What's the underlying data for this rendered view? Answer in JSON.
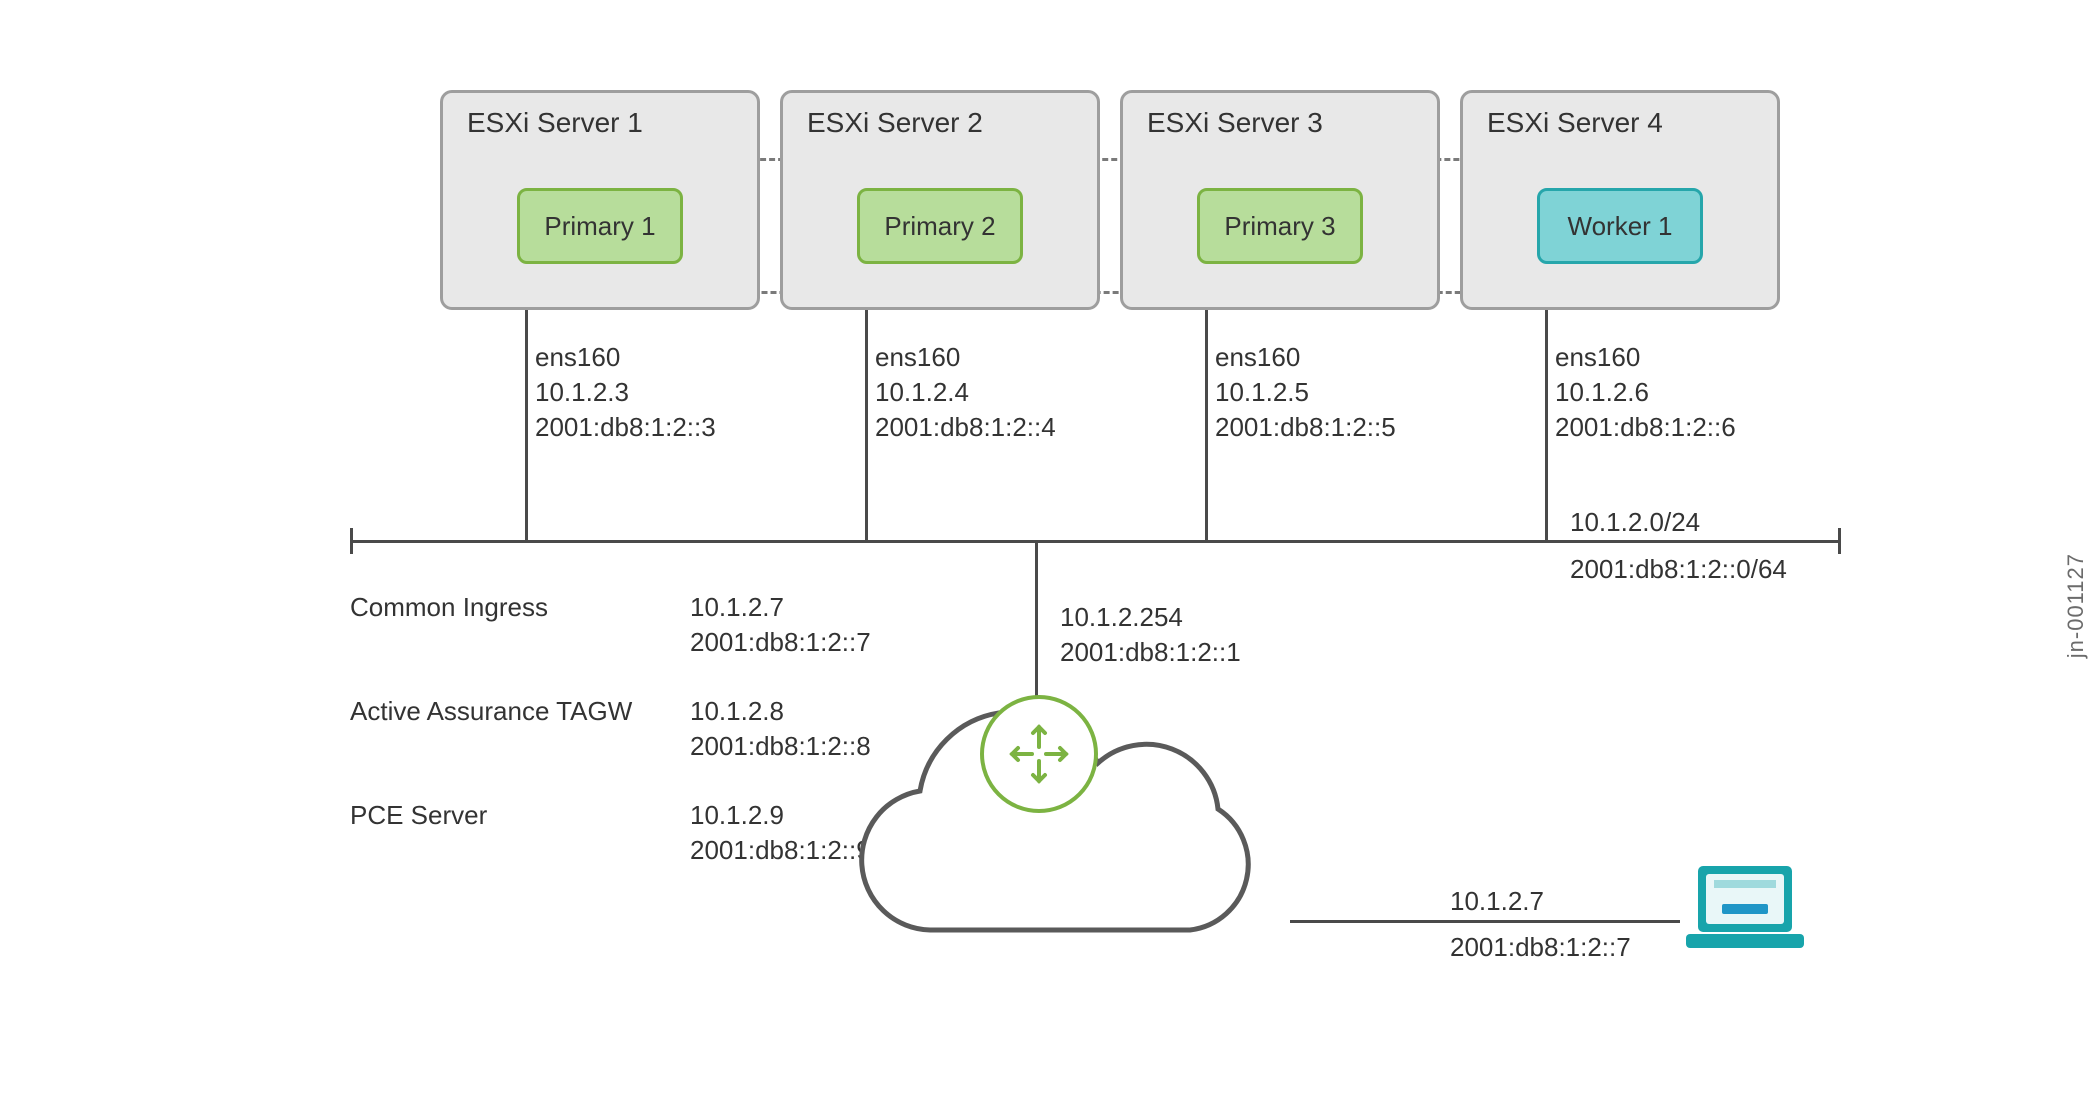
{
  "servers": [
    {
      "title": "ESXi Server 1",
      "vm": "Primary 1",
      "kind": "primary",
      "iface": "ens160",
      "ipv4": "10.1.2.3",
      "ipv6": "2001:db8:1:2::3"
    },
    {
      "title": "ESXi Server 2",
      "vm": "Primary 2",
      "kind": "primary",
      "iface": "ens160",
      "ipv4": "10.1.2.4",
      "ipv6": "2001:db8:1:2::4"
    },
    {
      "title": "ESXi Server 3",
      "vm": "Primary 3",
      "kind": "primary",
      "iface": "ens160",
      "ipv4": "10.1.2.5",
      "ipv6": "2001:db8:1:2::5"
    },
    {
      "title": "ESXi Server 4",
      "vm": "Worker 1",
      "kind": "worker",
      "iface": "ens160",
      "ipv4": "10.1.2.6",
      "ipv6": "2001:db8:1:2::6"
    }
  ],
  "subnet": {
    "ipv4": "10.1.2.0/24",
    "ipv6": "2001:db8:1:2::0/64"
  },
  "vips": [
    {
      "label": "Common Ingress",
      "ipv4": "10.1.2.7",
      "ipv6": "2001:db8:1:2::7"
    },
    {
      "label": "Active Assurance TAGW",
      "ipv4": "10.1.2.8",
      "ipv6": "2001:db8:1:2::8"
    },
    {
      "label": "PCE Server",
      "ipv4": "10.1.2.9",
      "ipv6": "2001:db8:1:2::9"
    }
  ],
  "gateway": {
    "ipv4": "10.1.2.254",
    "ipv6": "2001:db8:1:2::1"
  },
  "client": {
    "ipv4": "10.1.2.7",
    "ipv6": "2001:db8:1:2::7"
  },
  "ref": "jn-001127"
}
